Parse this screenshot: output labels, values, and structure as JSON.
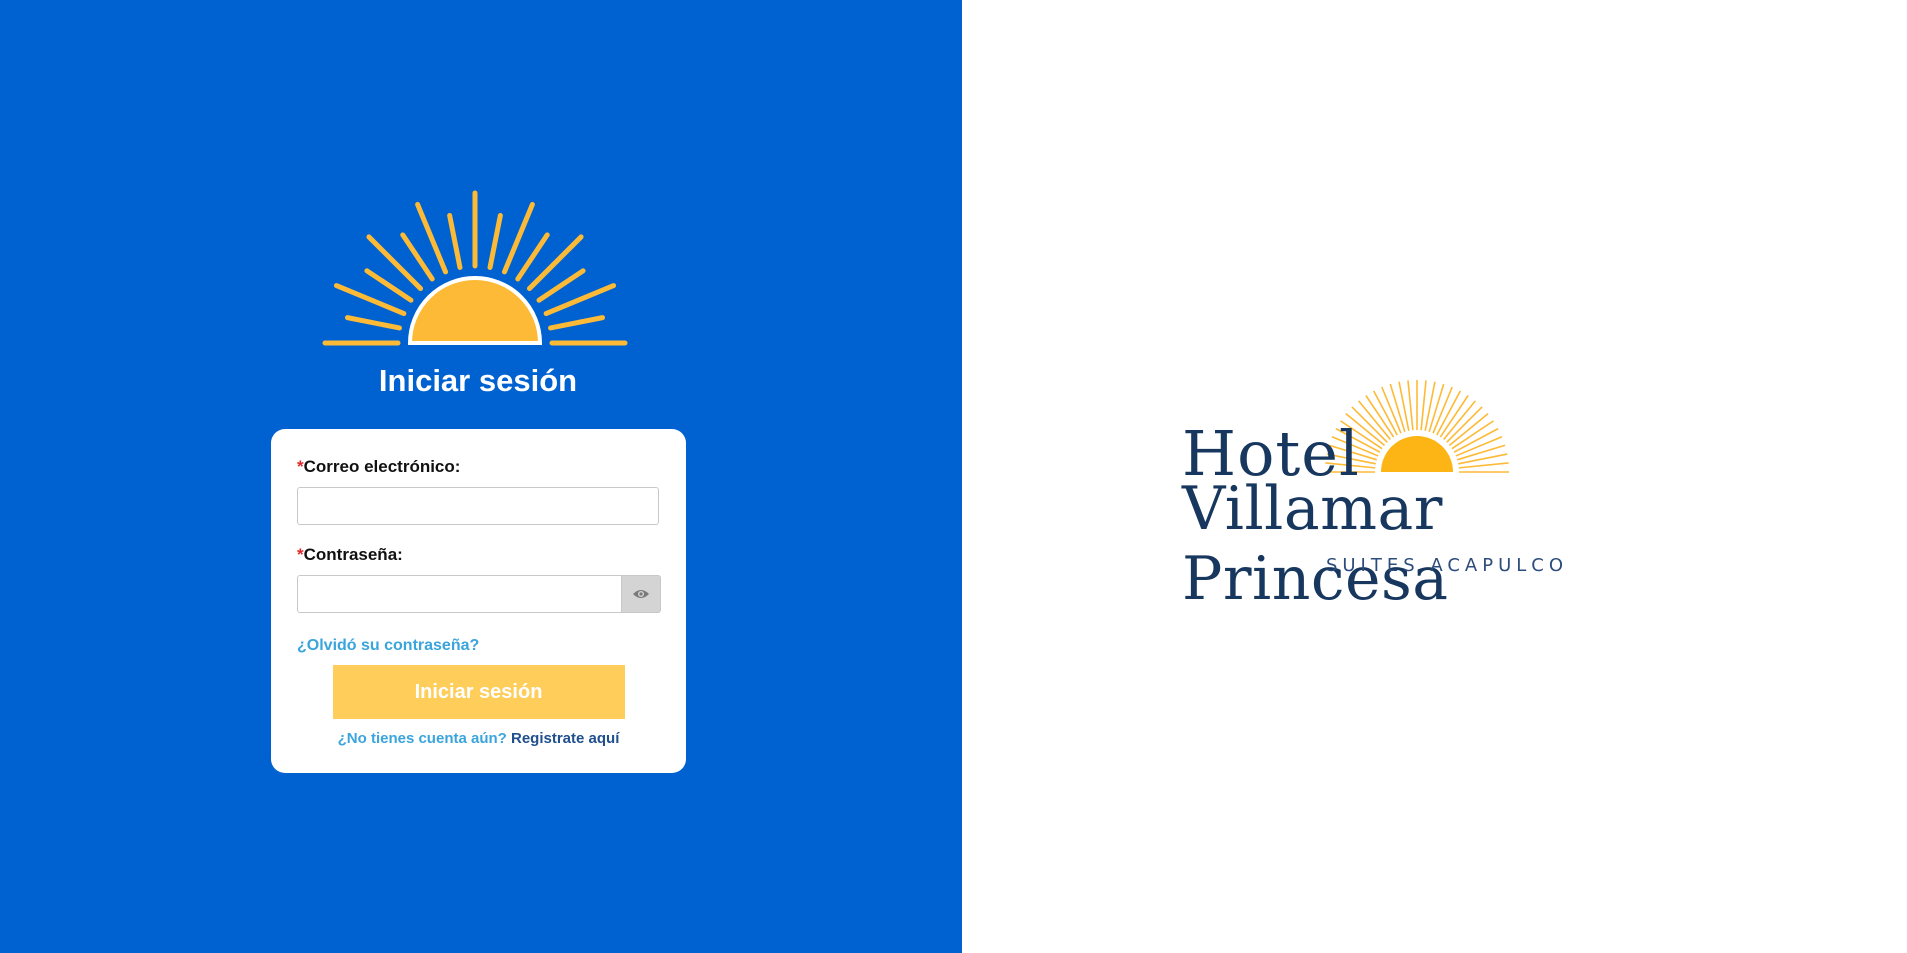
{
  "login": {
    "heading": "Iniciar sesión",
    "required_mark": "*",
    "email_label": "Correo electrónico:",
    "email_value": "",
    "password_label": "Contraseña:",
    "password_value": "",
    "forgot_link": "¿Olvidó su contraseña?",
    "submit_label": "Iniciar sesión",
    "register_prompt": "¿No tienes cuenta aún?",
    "register_link": "Registrate aquí"
  },
  "brand": {
    "line1": "Hotel",
    "line2": "Villamar Princesa",
    "tagline": "SUITES ACAPULCO"
  },
  "icons": {
    "sun": "sun-icon",
    "eye": "eye-icon"
  },
  "colors": {
    "left_background": "#0062d1",
    "sun_yellow": "#fdba36",
    "submit_button": "#fecd5a",
    "link_blue": "#3aa4dc",
    "brand_navy": "#17375f"
  }
}
